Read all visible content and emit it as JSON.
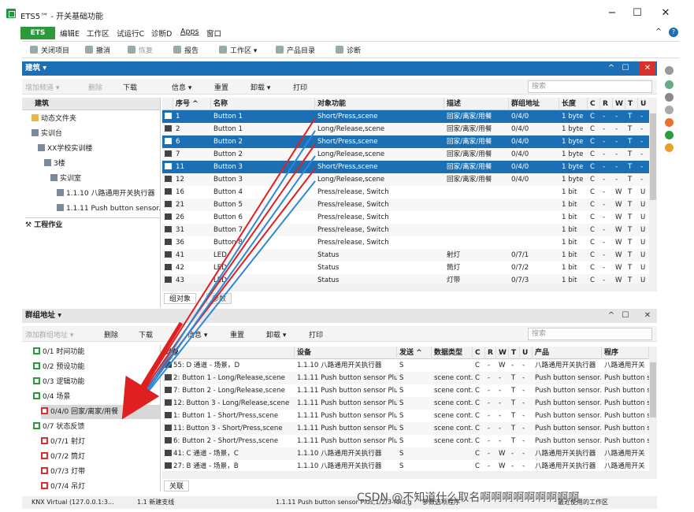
{
  "window": {
    "title": "ETS5™ - 开关基础功能",
    "minimize": "−",
    "maximize": "☐",
    "close": "✕"
  },
  "menu": {
    "ets": "ETS",
    "items": [
      "编辑E",
      "工作区",
      "试运行C",
      "诊断D",
      "Apps",
      "窗口"
    ],
    "help": "?",
    "collapse": "^"
  },
  "toolbar": {
    "items": [
      "关闭项目",
      "撤消",
      "恢复",
      "报告",
      "工作区 ▾",
      "产品目录",
      "诊断"
    ]
  },
  "building_panel": {
    "title": "建筑 ▾",
    "toolbar": {
      "add": "增加频道 ▾",
      "delete": "删除",
      "download": "下载",
      "info": "信息 ▾",
      "reset": "重置",
      "unload": "卸载 ▾",
      "print": "打印",
      "search_placeholder": "搜索"
    },
    "tree_header": "建筑",
    "tree": [
      {
        "label": "动态文件夹",
        "level": 1
      },
      {
        "label": "实训台",
        "level": 1
      },
      {
        "label": "XX学校实训楼",
        "level": 2
      },
      {
        "label": "3楼",
        "level": 3
      },
      {
        "label": "实训室",
        "level": 4
      },
      {
        "label": "1.1.10 八路通用开关执行器",
        "level": 5
      },
      {
        "label": "1.1.11 Push button sensor...",
        "level": 5
      }
    ],
    "work_label": "工程作业",
    "columns": [
      "序号 ^",
      "名称",
      "对象功能",
      "描述",
      "群组地址",
      "长度",
      "C",
      "R",
      "W",
      "T",
      "U"
    ],
    "rows": [
      {
        "num": "1",
        "name": "Button 1",
        "func": "Short/Press,scene",
        "desc": "回家/离家/用餐",
        "ga": "0/4/0",
        "len": "1 byte",
        "c": "C",
        "r": "-",
        "w": "-",
        "t": "T",
        "u": "-",
        "sel": true
      },
      {
        "num": "2",
        "name": "Button 1",
        "func": "Long/Release,scene",
        "desc": "回家/离家/用餐",
        "ga": "0/4/0",
        "len": "1 byte",
        "c": "C",
        "r": "-",
        "w": "-",
        "t": "T",
        "u": "-",
        "sel": false
      },
      {
        "num": "6",
        "name": "Button 2",
        "func": "Short/Press,scene",
        "desc": "回家/离家/用餐",
        "ga": "0/4/0",
        "len": "1 byte",
        "c": "C",
        "r": "-",
        "w": "-",
        "t": "T",
        "u": "-",
        "sel": true
      },
      {
        "num": "7",
        "name": "Button 2",
        "func": "Long/Release,scene",
        "desc": "回家/离家/用餐",
        "ga": "0/4/0",
        "len": "1 byte",
        "c": "C",
        "r": "-",
        "w": "-",
        "t": "T",
        "u": "-",
        "sel": false
      },
      {
        "num": "11",
        "name": "Button 3",
        "func": "Short/Press,scene",
        "desc": "回家/离家/用餐",
        "ga": "0/4/0",
        "len": "1 byte",
        "c": "C",
        "r": "-",
        "w": "-",
        "t": "T",
        "u": "-",
        "sel": true
      },
      {
        "num": "12",
        "name": "Button 3",
        "func": "Long/Release,scene",
        "desc": "回家/离家/用餐",
        "ga": "0/4/0",
        "len": "1 byte",
        "c": "C",
        "r": "-",
        "w": "-",
        "t": "T",
        "u": "-",
        "sel": false
      },
      {
        "num": "16",
        "name": "Button 4",
        "func": "Press/release, Switch",
        "desc": "",
        "ga": "",
        "len": "1 bit",
        "c": "C",
        "r": "-",
        "w": "W",
        "t": "T",
        "u": "U",
        "sel": false
      },
      {
        "num": "21",
        "name": "Button 5",
        "func": "Press/release, Switch",
        "desc": "",
        "ga": "",
        "len": "1 bit",
        "c": "C",
        "r": "-",
        "w": "W",
        "t": "T",
        "u": "U",
        "sel": false
      },
      {
        "num": "26",
        "name": "Button 6",
        "func": "Press/release, Switch",
        "desc": "",
        "ga": "",
        "len": "1 bit",
        "c": "C",
        "r": "-",
        "w": "W",
        "t": "T",
        "u": "U",
        "sel": false
      },
      {
        "num": "31",
        "name": "Button 7",
        "func": "Press/release, Switch",
        "desc": "",
        "ga": "",
        "len": "1 bit",
        "c": "C",
        "r": "-",
        "w": "W",
        "t": "T",
        "u": "U",
        "sel": false
      },
      {
        "num": "36",
        "name": "Button 8",
        "func": "Press/release, Switch",
        "desc": "",
        "ga": "",
        "len": "1 bit",
        "c": "C",
        "r": "-",
        "w": "W",
        "t": "T",
        "u": "U",
        "sel": false
      },
      {
        "num": "41",
        "name": "LED",
        "func": "Status",
        "desc": "射灯",
        "ga": "0/7/1",
        "len": "1 bit",
        "c": "C",
        "r": "-",
        "w": "W",
        "t": "T",
        "u": "U",
        "sel": false
      },
      {
        "num": "42",
        "name": "LED",
        "func": "Status",
        "desc": "筒灯",
        "ga": "0/7/2",
        "len": "1 bit",
        "c": "C",
        "r": "-",
        "w": "W",
        "t": "T",
        "u": "U",
        "sel": false
      },
      {
        "num": "43",
        "name": "LED",
        "func": "Status",
        "desc": "灯带",
        "ga": "0/7/3",
        "len": "1 bit",
        "c": "C",
        "r": "-",
        "w": "W",
        "t": "T",
        "u": "U",
        "sel": false
      }
    ],
    "tabs": [
      "组对象",
      "参数"
    ]
  },
  "ga_panel": {
    "title": "群组地址 ▾",
    "toolbar": {
      "add": "添加群组地址 ▾",
      "delete": "删除",
      "download": "下载",
      "info": "信息 ▾",
      "reset": "重置",
      "unload": "卸载 ▾",
      "print": "打印",
      "search_placeholder": "搜索"
    },
    "tree": [
      {
        "label": "0/1 时间功能",
        "level": 1,
        "red": false
      },
      {
        "label": "0/2 预设功能",
        "level": 1,
        "red": false
      },
      {
        "label": "0/3 逻辑功能",
        "level": 1,
        "red": false
      },
      {
        "label": "0/4 场景",
        "level": 1,
        "red": false
      },
      {
        "label": "0/4/0 回家/离家/用餐",
        "level": 2,
        "red": true,
        "sel": true
      },
      {
        "label": "0/7 状态反馈",
        "level": 1,
        "red": false
      },
      {
        "label": "0/7/1 射灯",
        "level": 2,
        "red": true
      },
      {
        "label": "0/7/2 筒灯",
        "level": 2,
        "red": true
      },
      {
        "label": "0/7/3 灯带",
        "level": 2,
        "red": true
      },
      {
        "label": "0/7/4 吊灯",
        "level": 2,
        "red": true
      }
    ],
    "columns": [
      "对象",
      "设备",
      "发送 ^",
      "数据类型",
      "C",
      "R",
      "W",
      "T",
      "U",
      "产品",
      "程序"
    ],
    "rows": [
      {
        "obj": "55: D 通道 - 场景，D",
        "dev": "1.1.10 八路通用开关执行器",
        "send": "S",
        "dtype": "",
        "c": "C",
        "r": "-",
        "w": "W",
        "t": "-",
        "u": "-",
        "prod": "八路通用开关执行器",
        "prog": "八路通用开关"
      },
      {
        "obj": "2: Button 1 - Long/Release,scene",
        "dev": "1.1.11 Push button sensor Plus,...",
        "send": "S",
        "dtype": "scene cont...",
        "c": "C",
        "r": "-",
        "w": "-",
        "t": "T",
        "u": "-",
        "prod": "Push button sensor...",
        "prog": "Push button s"
      },
      {
        "obj": "7: Button 2 - Long/Release,scene",
        "dev": "1.1.11 Push button sensor Plus,...",
        "send": "S",
        "dtype": "scene cont...",
        "c": "C",
        "r": "-",
        "w": "-",
        "t": "T",
        "u": "-",
        "prod": "Push button sensor...",
        "prog": "Push button s"
      },
      {
        "obj": "12: Button 3 - Long/Release,scene",
        "dev": "1.1.11 Push button sensor Plus,...",
        "send": "S",
        "dtype": "scene cont...",
        "c": "C",
        "r": "-",
        "w": "-",
        "t": "T",
        "u": "-",
        "prod": "Push button sensor...",
        "prog": "Push button s"
      },
      {
        "obj": "1: Button 1 - Short/Press,scene",
        "dev": "1.1.11 Push button sensor Plus,...",
        "send": "S",
        "dtype": "scene cont...",
        "c": "C",
        "r": "-",
        "w": "-",
        "t": "T",
        "u": "-",
        "prod": "Push button sensor...",
        "prog": "Push button s"
      },
      {
        "obj": "11: Button 3 - Short/Press,scene",
        "dev": "1.1.11 Push button sensor Plus,...",
        "send": "S",
        "dtype": "scene cont...",
        "c": "C",
        "r": "-",
        "w": "-",
        "t": "T",
        "u": "-",
        "prod": "Push button sensor...",
        "prog": "Push button s"
      },
      {
        "obj": "6: Button 2 - Short/Press,scene",
        "dev": "1.1.11 Push button sensor Plus,...",
        "send": "S",
        "dtype": "scene cont...",
        "c": "C",
        "r": "-",
        "w": "-",
        "t": "T",
        "u": "-",
        "prod": "Push button sensor...",
        "prog": "Push button s"
      },
      {
        "obj": "41: C 通道 - 场景，C",
        "dev": "1.1.10 八路通用开关执行器",
        "send": "S",
        "dtype": "",
        "c": "C",
        "r": "-",
        "w": "W",
        "t": "-",
        "u": "-",
        "prod": "八路通用开关执行器",
        "prog": "八路通用开关"
      },
      {
        "obj": "27: B 通道 - 场景，B",
        "dev": "1.1.10 八路通用开关执行器",
        "send": "S",
        "dtype": "",
        "c": "C",
        "r": "-",
        "w": "W",
        "t": "-",
        "u": "-",
        "prod": "八路通用开关执行器",
        "prog": "八路通用开关"
      }
    ],
    "tabs": [
      "关联"
    ]
  },
  "status": {
    "conn": "KNX Virtual  (127.0.0.1:3...",
    "line": "1.1 新建支线",
    "device": "1.1.11 Push button sensor Plus,1/2/3-fold,g",
    "mode": "参数选项程序",
    "last": "最近使用的工作区"
  },
  "watermark": "CSDN @不知道什么取名啊啊啊啊啊啊啊啊啊"
}
